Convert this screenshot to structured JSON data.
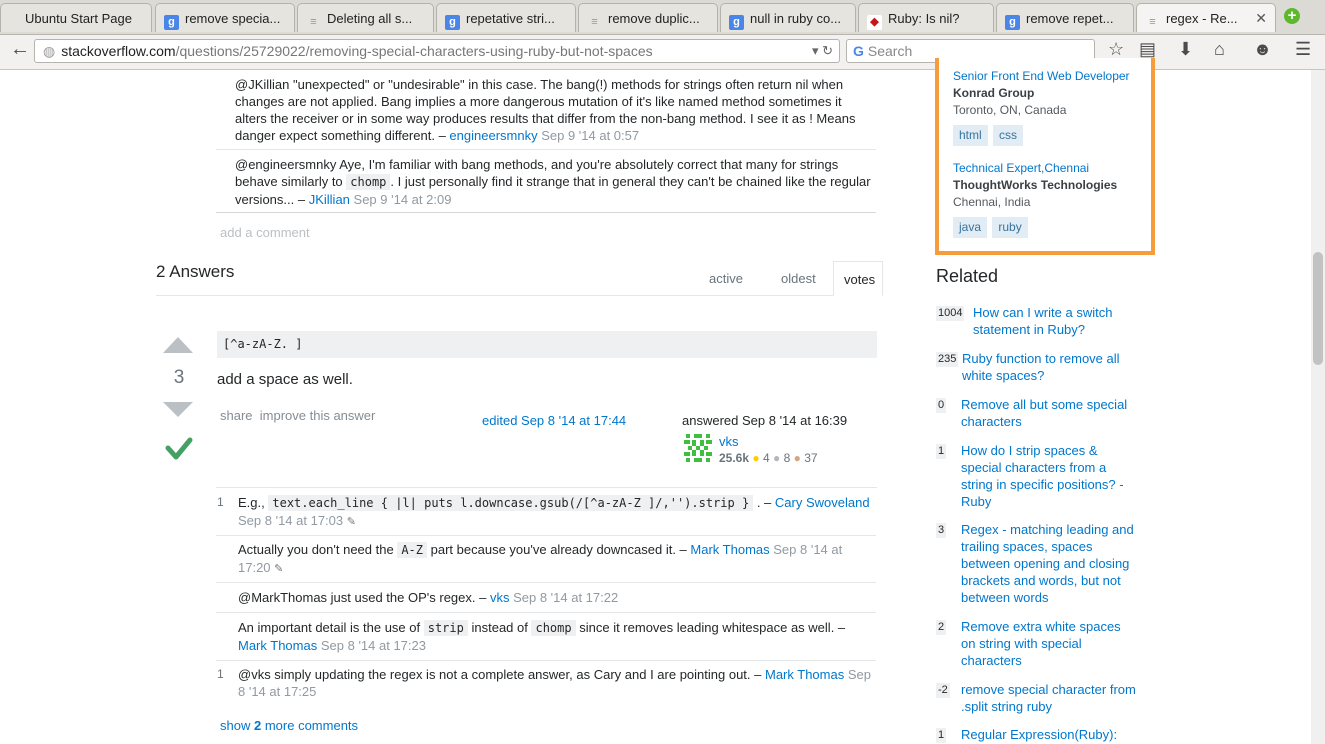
{
  "browser": {
    "tabs": [
      {
        "label": "Ubuntu Start Page",
        "favicon": ""
      },
      {
        "label": "remove specia...",
        "favicon": "g"
      },
      {
        "label": "Deleting all s...",
        "favicon": "so"
      },
      {
        "label": "repetative stri...",
        "favicon": "g"
      },
      {
        "label": "remove duplic...",
        "favicon": "so"
      },
      {
        "label": "null in ruby co...",
        "favicon": "g"
      },
      {
        "label": "Ruby: Is nil?",
        "favicon": "ruby"
      },
      {
        "label": "remove repet...",
        "favicon": "g"
      },
      {
        "label": "regex - Re...",
        "favicon": "so",
        "active": true
      }
    ],
    "url_host": "stackoverflow.com",
    "url_path": "/questions/25729022/removing-special-characters-using-ruby-but-not-spaces",
    "search_placeholder": "Search"
  },
  "question_comments": [
    {
      "text": "@JKillian \"unexpected\" or \"undesirable\" in this case. The bang(!) methods for strings often return nil when changes are not applied. Bang implies a more dangerous mutation of it's like named method sometimes it alters the receiver or in some way produces results that differ from the non-bang method. I see it as ! Means danger expect something different.",
      "user": "engineersmnky",
      "date": "Sep 9 '14 at 0:57"
    },
    {
      "text_a": "@engineersmnky Aye, I'm familiar with bang methods, and you're absolutely correct that many for strings behave similarly to",
      "code": "chomp",
      "text_b": ". I just personally find it strange that in general they can't be chained like the regular versions...",
      "user": "JKillian",
      "date": "Sep 9 '14 at 2:09"
    }
  ],
  "add_comment": "add a comment",
  "answers": {
    "heading": "2 Answers",
    "tabs": [
      "active",
      "oldest",
      "votes"
    ],
    "active_tab": "votes"
  },
  "answer": {
    "score": "3",
    "code": "[^a-zA-Z. ]",
    "text": "add a space as well.",
    "share": "share",
    "improve": "improve this answer",
    "edited": "edited Sep 8 '14 at 17:44",
    "answered": "answered Sep 8 '14 at 16:39",
    "user": "vks",
    "rep": "25.6k",
    "gold": "4",
    "silver": "8",
    "bronze": "37"
  },
  "answer_comments": [
    {
      "score": "1",
      "pre": "E.g.,",
      "code": "text.each_line { |l| puts l.downcase.gsub(/[^a-zA-Z ]/,'').strip }",
      "post": ". –",
      "user": "Cary Swoveland",
      "date": "Sep 8 '14 at 17:03"
    },
    {
      "score": "",
      "pre": "Actually you don't need the",
      "code": "A-Z",
      "post": "part because you've already downcased it. –",
      "user": "Mark Thomas",
      "date": "Sep 8 '14 at",
      "date2": "17:20"
    },
    {
      "score": "",
      "pre": "@MarkThomas just used the OP's regex. –",
      "user": "vks",
      "date": "Sep 8 '14 at 17:22"
    },
    {
      "score": "",
      "pre": "An important detail is the use of",
      "code": "strip",
      "mid": "instead of",
      "code2": "chomp",
      "post": "since it removes leading whitespace as well. –",
      "user": "Mark Thomas",
      "date": "Sep 8 '14 at 17:23"
    },
    {
      "score": "1",
      "pre": "@vks simply updating the regex is not a complete answer, as Cary and I are pointing out. –",
      "user": "Mark Thomas",
      "date": "Sep 8 '14 at 17:25"
    }
  ],
  "show_more": {
    "pre": "show",
    "count": "2",
    "post": "more comments"
  },
  "jobs": [
    {
      "title": "Senior Front End Web Developer",
      "company": "Konrad Group",
      "location": "Toronto, ON, Canada",
      "tags": [
        "html",
        "css"
      ]
    },
    {
      "title": "Technical Expert,Chennai",
      "company": "ThoughtWorks Technologies",
      "location": "Chennai, India",
      "tags": [
        "java",
        "ruby"
      ]
    }
  ],
  "related": {
    "heading": "Related",
    "items": [
      {
        "score": "1004",
        "title": "How can I write a switch statement in Ruby?"
      },
      {
        "score": "235",
        "title": "Ruby function to remove all white spaces?"
      },
      {
        "score": "0",
        "title": "Remove all but some special characters"
      },
      {
        "score": "1",
        "title": "How do I strip spaces & special characters from a string in specific positions? - Ruby"
      },
      {
        "score": "3",
        "title": "Regex - matching leading and trailing spaces, spaces between opening and closing brackets and words, but not between words"
      },
      {
        "score": "2",
        "title": "Remove extra white spaces on string with special characters"
      },
      {
        "score": "-2",
        "title": "remove special character from .split string ruby"
      },
      {
        "score": "1",
        "title": "Regular Expression(Ruby):"
      }
    ]
  },
  "colors": {
    "link": "#0077cc",
    "accept": "#45a163",
    "jobs_border": "#f69c3d",
    "tag_bg": "#e1ecf4"
  }
}
